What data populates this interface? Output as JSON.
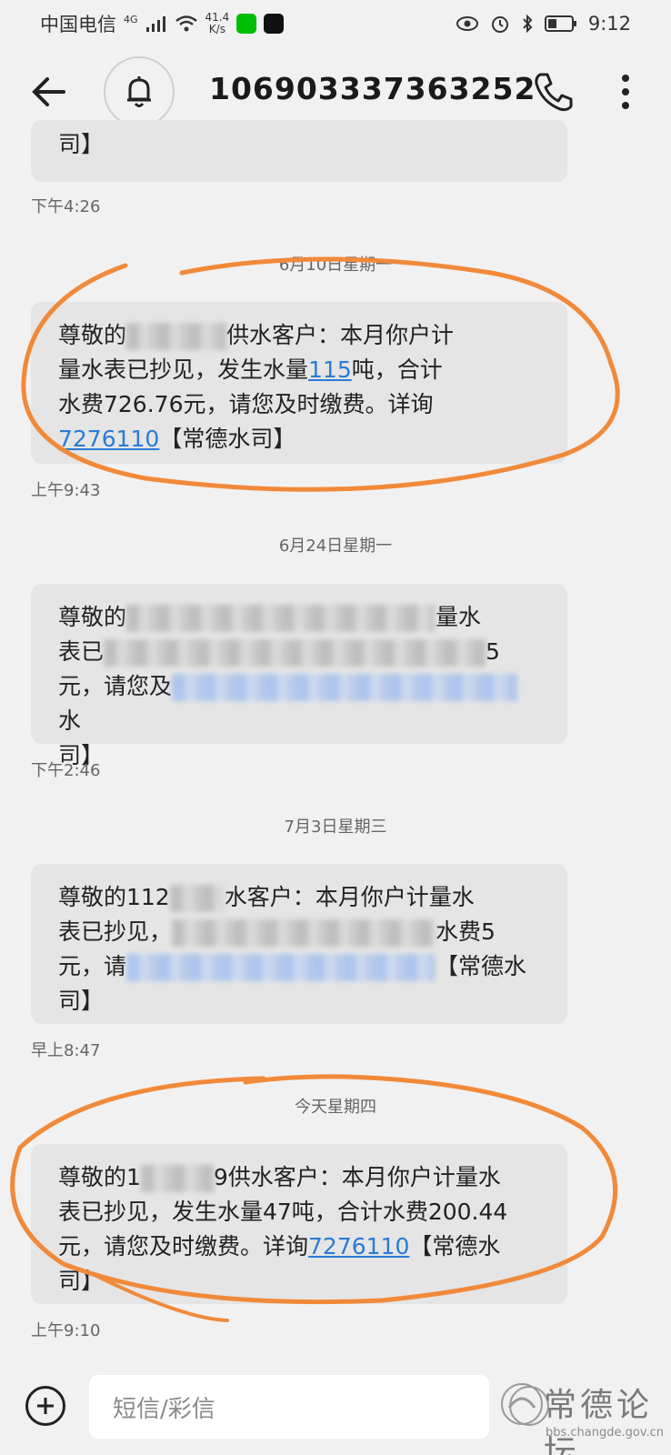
{
  "status_bar": {
    "carrier": "中国电信",
    "network": "4G",
    "speed_value": "41.4",
    "speed_unit": "K/s",
    "time": "9:12"
  },
  "header": {
    "phone_number": "106903337363252"
  },
  "thread": {
    "top_partial": {
      "text_tail": "司】",
      "time": "下午4:26"
    },
    "groups": [
      {
        "date": "6月10日星期一",
        "lines": [
          "尊敬的",
          "供水客户：本月你户计",
          "量水表已抄见，发生水量",
          "115",
          "吨，合计",
          "水费726.76元，请您及时缴费。详询",
          "7276110",
          "【常德水司】"
        ],
        "time": "上午9:43"
      },
      {
        "date": "6月24日星期一",
        "line1_start": "尊敬的",
        "line1_end": "量水",
        "line2_start": "表已",
        "line2_end": "5",
        "line3_start": "元，请您及",
        "line3_end": "水",
        "line4": "司】",
        "time": "下午2:46"
      },
      {
        "date": "7月3日星期三",
        "line1_start": "尊敬的112",
        "line1_mid": "水客户：本月你户计量水",
        "line2_start": "表已抄见，",
        "line2_mid": "水费5",
        "line3_start": "元，请",
        "line3_end": "【常德水",
        "line4": "司】",
        "time": "早上8:47"
      },
      {
        "date": "今天星期四",
        "line1_start": "尊敬的1",
        "line1_end": "9供水客户：本月你户计量水",
        "line2": "表已抄见，发生水量47吨，合计水费200.44",
        "line3_start": "元，请您及时缴费。详询",
        "line3_link": "7276110",
        "line3_end": "【常德水",
        "line4": "司】",
        "time": "上午9:10"
      }
    ]
  },
  "composer": {
    "placeholder": "短信/彩信"
  },
  "watermark": {
    "title": "常德论坛",
    "url": "bbs.changde.gov.cn"
  },
  "colors": {
    "link": "#2b7bd6",
    "annotation": "#f08a3a",
    "bubble": "#e5e5e5"
  }
}
